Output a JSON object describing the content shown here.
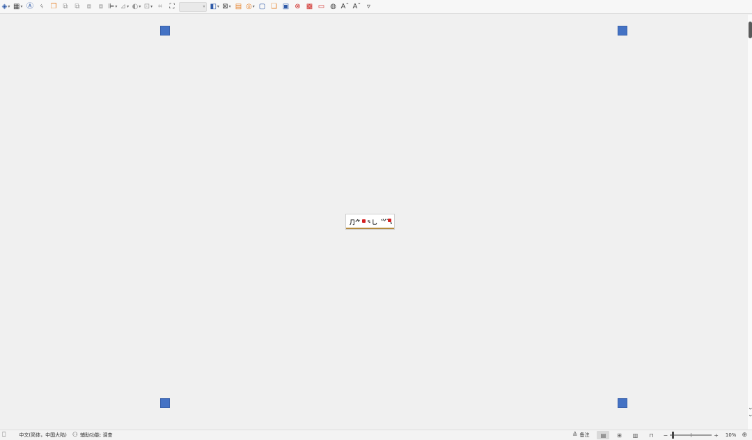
{
  "toolbar": {
    "buttons": [
      {
        "name": "shapes",
        "icon": "shapes-icon",
        "glyph": "◈",
        "caret": true,
        "tone": "blue"
      },
      {
        "name": "table",
        "icon": "table-icon",
        "glyph": "▦",
        "caret": true,
        "tone": ""
      },
      {
        "name": "textbox",
        "icon": "textbox-icon",
        "glyph": "Ⓐ",
        "caret": false,
        "tone": "blue"
      },
      {
        "name": "fontwork",
        "icon": "fontwork-icon",
        "glyph": "ᛃ",
        "caret": false,
        "tone": ""
      },
      {
        "name": "insert-image",
        "icon": "image-icon",
        "glyph": "❐",
        "caret": false,
        "tone": "orange"
      },
      {
        "name": "bring-forward",
        "icon": "bring-forward-icon",
        "glyph": "⧉",
        "caret": false,
        "tone": "gray"
      },
      {
        "name": "send-backward",
        "icon": "send-backward-icon",
        "glyph": "⧉",
        "caret": false,
        "tone": "gray"
      },
      {
        "name": "bring-to-front",
        "icon": "bring-to-front-icon",
        "glyph": "⧈",
        "caret": false,
        "tone": "gray"
      },
      {
        "name": "send-to-back",
        "icon": "send-to-back-icon",
        "glyph": "⧈",
        "caret": false,
        "tone": "gray"
      },
      {
        "name": "align",
        "icon": "align-icon",
        "glyph": "⊫",
        "caret": true,
        "tone": ""
      },
      {
        "name": "arrange",
        "icon": "arrange-icon",
        "glyph": "⊿",
        "caret": true,
        "tone": "gray"
      },
      {
        "name": "wrap",
        "icon": "wrap-icon",
        "glyph": "◐",
        "caret": true,
        "tone": "gray"
      },
      {
        "name": "group",
        "icon": "group-icon",
        "glyph": "⊡",
        "caret": true,
        "tone": "gray"
      },
      {
        "name": "crop",
        "icon": "crop-icon",
        "glyph": "⌗",
        "caret": false,
        "tone": "gray"
      },
      {
        "name": "frame",
        "icon": "frame-icon",
        "glyph": "⛶",
        "caret": false,
        "tone": ""
      }
    ],
    "buttons_after_combo": [
      {
        "name": "color",
        "icon": "color-fill-icon",
        "glyph": "◧",
        "caret": true,
        "tone": "blue"
      },
      {
        "name": "text-wrap",
        "icon": "text-wrap-icon",
        "glyph": "⊠",
        "caret": true,
        "tone": ""
      },
      {
        "name": "highlight",
        "icon": "highlight-icon",
        "glyph": "▤",
        "caret": false,
        "tone": "orange"
      },
      {
        "name": "filter",
        "icon": "filter-icon",
        "glyph": "◎",
        "caret": true,
        "tone": "orange"
      },
      {
        "name": "frame-border",
        "icon": "frame-border-icon",
        "glyph": "▢",
        "caret": false,
        "tone": "blue"
      },
      {
        "name": "properties",
        "icon": "properties-icon",
        "glyph": "❏",
        "caret": false,
        "tone": "orange"
      },
      {
        "name": "transparency",
        "icon": "transparency-icon",
        "glyph": "▣",
        "caret": false,
        "tone": "blue"
      },
      {
        "name": "reset",
        "icon": "reset-icon",
        "glyph": "⊗",
        "caret": false,
        "tone": "red"
      },
      {
        "name": "compress",
        "icon": "compress-icon",
        "glyph": "▩",
        "caret": false,
        "tone": "red"
      },
      {
        "name": "rotate",
        "icon": "rotate-icon",
        "glyph": "▭",
        "caret": false,
        "tone": "red"
      },
      {
        "name": "outline",
        "icon": "outline-icon",
        "glyph": "◍",
        "caret": false,
        "tone": ""
      },
      {
        "name": "grow-font",
        "icon": "grow-font-icon",
        "glyph": "Aˆ",
        "caret": false,
        "tone": ""
      },
      {
        "name": "shrink-font",
        "icon": "shrink-font-icon",
        "glyph": "Aˇ",
        "caret": false,
        "tone": ""
      },
      {
        "name": "more",
        "icon": "more-icon",
        "glyph": "▿",
        "caret": false,
        "tone": ""
      }
    ],
    "combo_value": ""
  },
  "statusbar": {
    "language": "中文(简体，中国大陆)",
    "accessibility": "辅助功能: 调查",
    "notes_label": "备注",
    "zoom_minus": "−",
    "zoom_plus": "+",
    "zoom_level": "10%",
    "zoom_fraction": 0.04
  }
}
